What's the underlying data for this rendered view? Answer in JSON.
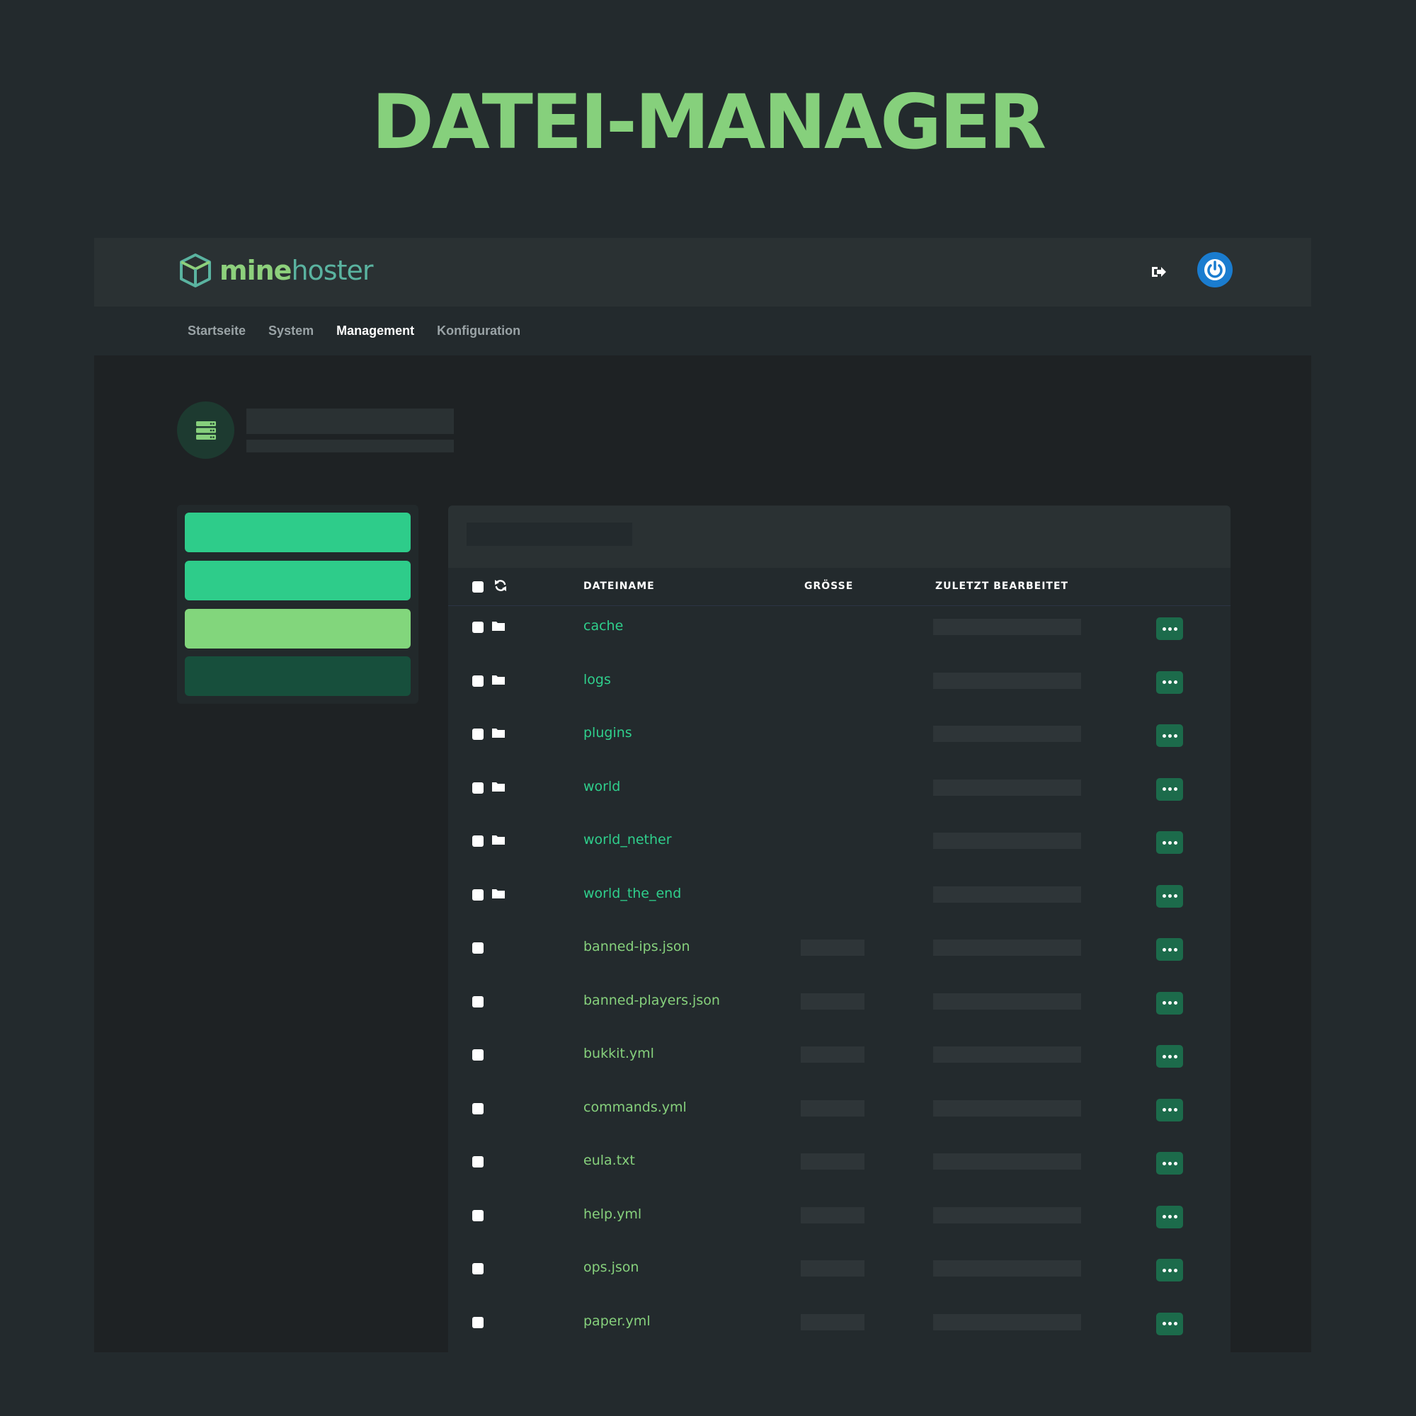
{
  "headline": "DATEI-MANAGER",
  "brand": {
    "part1": "mine",
    "part2": "hoster"
  },
  "header": {
    "logout_icon": "logout-icon",
    "power_icon": "power-icon"
  },
  "nav": [
    {
      "label": "Startseite",
      "active": false
    },
    {
      "label": "System",
      "active": false
    },
    {
      "label": "Management",
      "active": true
    },
    {
      "label": "Konfiguration",
      "active": false
    }
  ],
  "sidebar_buttons": [
    {
      "color": "#2ecc8a"
    },
    {
      "color": "#2ecc8a"
    },
    {
      "color": "#82d67c"
    },
    {
      "color": "#174f3c"
    }
  ],
  "table": {
    "columns": {
      "name": "DATEINAME",
      "size": "GRÖSSE",
      "modified": "ZULETZT BEARBEITET"
    },
    "rows": [
      {
        "name": "cache",
        "type": "folder"
      },
      {
        "name": "logs",
        "type": "folder"
      },
      {
        "name": "plugins",
        "type": "folder"
      },
      {
        "name": "world",
        "type": "folder"
      },
      {
        "name": "world_nether",
        "type": "folder"
      },
      {
        "name": "world_the_end",
        "type": "folder"
      },
      {
        "name": "banned-ips.json",
        "type": "file"
      },
      {
        "name": "banned-players.json",
        "type": "file"
      },
      {
        "name": "bukkit.yml",
        "type": "file"
      },
      {
        "name": "commands.yml",
        "type": "file"
      },
      {
        "name": "eula.txt",
        "type": "file"
      },
      {
        "name": "help.yml",
        "type": "file"
      },
      {
        "name": "ops.json",
        "type": "file"
      },
      {
        "name": "paper.yml",
        "type": "file"
      }
    ]
  },
  "colors": {
    "accent": "#86d07c",
    "folder_link": "#2fcf8c",
    "action": "#1c6b4b",
    "power": "#1a7ccf"
  }
}
